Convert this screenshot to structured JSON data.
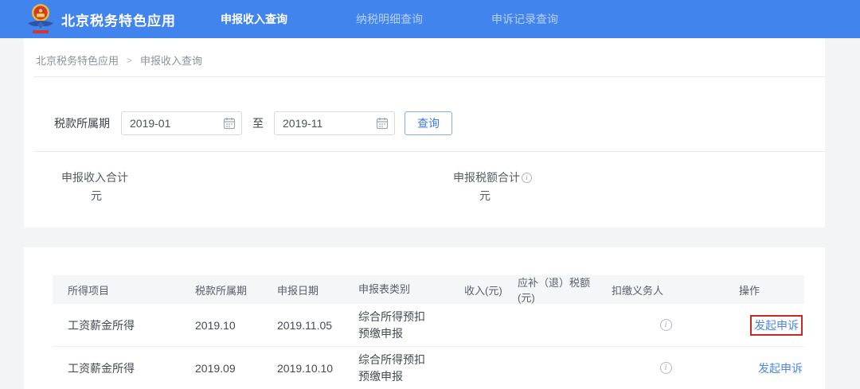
{
  "header": {
    "title": "北京税务特色应用",
    "nav": [
      {
        "label": "申报收入查询"
      },
      {
        "label": "纳税明细查询"
      },
      {
        "label": "申诉记录查询"
      }
    ]
  },
  "breadcrumb": {
    "root": "北京税务特色应用",
    "separator": ">",
    "current": "申报收入查询"
  },
  "filter": {
    "period_label": "税款所属期",
    "start_value": "2019-01",
    "to_label": "至",
    "end_value": "2019-11",
    "query_button": "查询"
  },
  "summary": {
    "income_label": "申报收入合计",
    "income_value": "",
    "income_unit": "元",
    "tax_label": "申报税额合计",
    "tax_value": "",
    "tax_unit": "元"
  },
  "table": {
    "columns": [
      "所得项目",
      "税款所属期",
      "申报日期",
      "申报表类别",
      "收入(元)",
      "应补（退）税额(元)",
      "扣缴义务人",
      "操作"
    ],
    "rows": [
      {
        "income_type": "工资薪金所得",
        "tax_period": "2019.10",
        "declare_date": "2019.11.05",
        "form_type": "综合所得预扣\n预缴申报",
        "income": "",
        "refund": "",
        "action": "发起申诉"
      },
      {
        "income_type": "工资薪金所得",
        "tax_period": "2019.09",
        "declare_date": "2019.10.10",
        "form_type": "综合所得预扣\n预缴申报",
        "income": "",
        "refund": "",
        "action": "发起申诉"
      }
    ]
  },
  "icons": {
    "info_glyph": "i"
  },
  "colors": {
    "header_blue": "#4184ee",
    "link_blue": "#4a87e8",
    "highlight_red": "#c52b22",
    "page_background": "#f3f4f6"
  }
}
